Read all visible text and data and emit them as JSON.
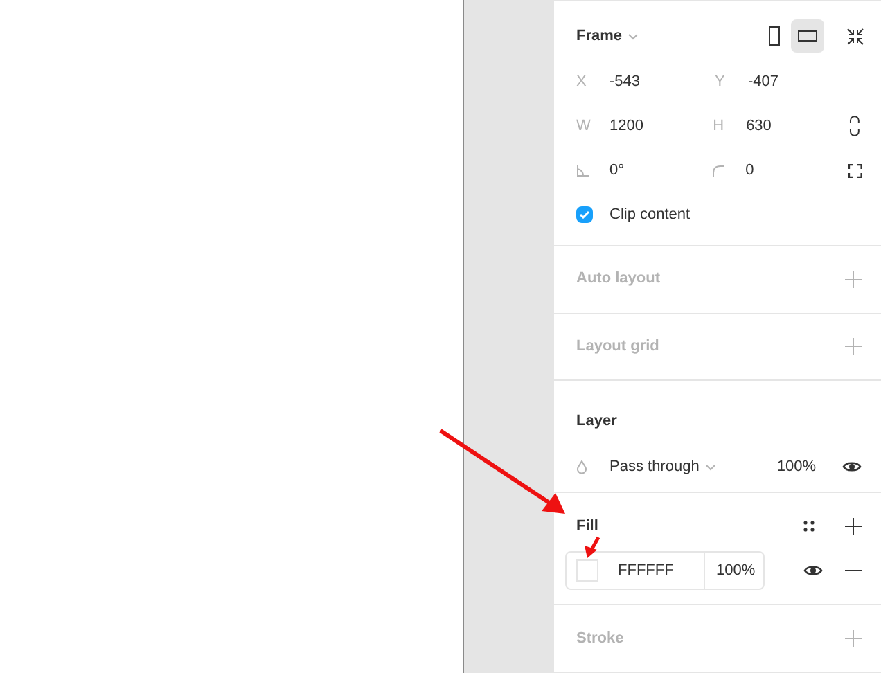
{
  "frame": {
    "title": "Frame",
    "orientations": [
      {
        "kind": "portrait",
        "selected": false
      },
      {
        "kind": "landscape",
        "selected": true
      }
    ],
    "fields": [
      {
        "label": "X",
        "value": "-543"
      },
      {
        "label": "Y",
        "value": "-407"
      },
      {
        "label": "W",
        "value": "1200"
      },
      {
        "label": "H",
        "value": "630"
      },
      {
        "kind": "rotation",
        "value": "0°"
      },
      {
        "kind": "radius",
        "value": "0"
      }
    ],
    "clip_content": {
      "label": "Clip content",
      "checked": true
    }
  },
  "auto_layout": {
    "title": "Auto layout",
    "active": false
  },
  "layout_grid": {
    "title": "Layout grid",
    "active": false
  },
  "layer": {
    "title": "Layer",
    "blend_mode": "Pass through",
    "opacity": "100%",
    "visible": true
  },
  "fill": {
    "title": "Fill",
    "active": true,
    "hex": "FFFFFF",
    "color": "#ffffff",
    "opacity": "100%",
    "visible": true
  },
  "stroke": {
    "title": "Stroke",
    "active": false
  }
}
